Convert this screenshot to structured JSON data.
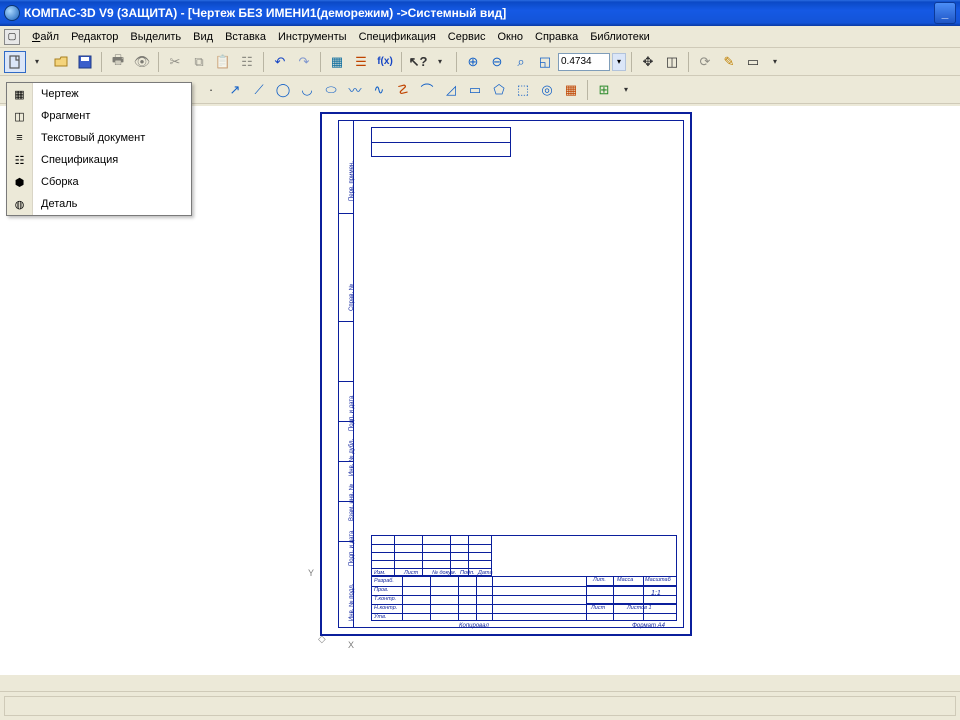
{
  "titlebar": {
    "text": "КОМПАС-3D V9 (ЗАЩИТА) - [Чертеж БЕЗ ИМЕНИ1(деморежим) ->Системный вид]"
  },
  "menu": {
    "items": [
      "Файл",
      "Редактор",
      "Выделить",
      "Вид",
      "Вставка",
      "Инструменты",
      "Спецификация",
      "Сервис",
      "Окно",
      "Справка",
      "Библиотеки"
    ]
  },
  "toolbar": {
    "zoom_value": "0.4734"
  },
  "newmenu": {
    "items": [
      {
        "label": "Чертеж",
        "icon": "drawing-icon"
      },
      {
        "label": "Фрагмент",
        "icon": "fragment-icon"
      },
      {
        "label": "Текстовый документ",
        "icon": "text-doc-icon"
      },
      {
        "label": "Спецификация",
        "icon": "spec-icon"
      },
      {
        "label": "Сборка",
        "icon": "assembly-icon"
      },
      {
        "label": "Деталь",
        "icon": "part-icon"
      }
    ]
  },
  "sheet": {
    "side_labels": [
      "Перв. примен.",
      "Справ. №",
      "Подп. и дата",
      "Инв. № дубл.",
      "Взам. инв. №",
      "Подп. и дата",
      "Инв. № подл."
    ],
    "block": {
      "header_cells": [
        "Изм.",
        "Лист",
        "№ докум.",
        "Подп.",
        "Дата"
      ],
      "role_rows": [
        "Разраб.",
        "Пров.",
        "Т.контр.",
        "Н.контр.",
        "Утв."
      ],
      "right_top": [
        "Лит.",
        "Масса",
        "Масштаб"
      ],
      "right_mid": "1:1",
      "right_bottom_left": "Лист",
      "right_bottom_right": "Листов 1",
      "copied": "Копировал",
      "format": "Формат  A4"
    },
    "axes": {
      "y": "Y",
      "x": "X"
    }
  }
}
